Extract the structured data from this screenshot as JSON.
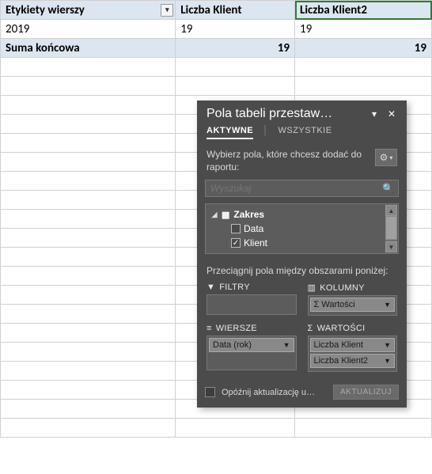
{
  "pivot": {
    "headers": {
      "row_labels": "Etykiety wierszy",
      "col1": "Liczba Klient",
      "col2": "Liczba Klient2"
    },
    "rows": [
      {
        "label": "2019",
        "v1": "19",
        "v2": "19"
      }
    ],
    "grand": {
      "label": "Suma końcowa",
      "v1": "19",
      "v2": "19"
    }
  },
  "pane": {
    "title": "Pola tabeli przestaw…",
    "tabs": {
      "active": "AKTYWNE",
      "all": "WSZYSTKIE"
    },
    "instruction": "Wybierz pola, które chcesz dodać do raportu:",
    "search_placeholder": "Wyszukaj",
    "fields": {
      "table": "Zakres",
      "items": [
        {
          "name": "Data",
          "checked": false
        },
        {
          "name": "Klient",
          "checked": true
        }
      ]
    },
    "drag_instruction": "Przeciągnij pola między obszarami poniżej:",
    "areas": {
      "filters": {
        "label": "FILTRY"
      },
      "columns": {
        "label": "KOLUMNY",
        "items": [
          "Σ Wartości"
        ]
      },
      "rows": {
        "label": "WIERSZE",
        "items": [
          "Data (rok)"
        ]
      },
      "values": {
        "label": "WARTOŚCI",
        "items": [
          "Liczba Klient",
          "Liczba Klient2"
        ]
      }
    },
    "defer": "Opóźnij aktualizację u…",
    "update": "AKTUALIZUJ"
  }
}
